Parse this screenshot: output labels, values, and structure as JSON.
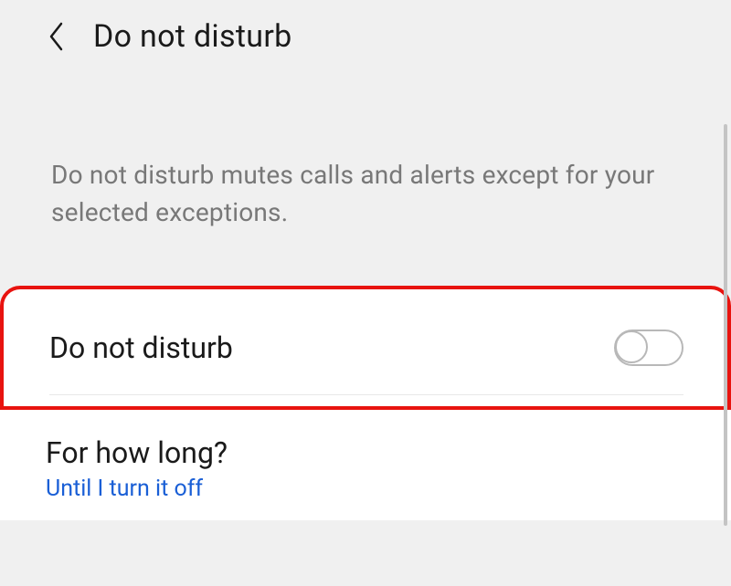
{
  "header": {
    "title": "Do not disturb"
  },
  "description": "Do not disturb mutes calls and alerts except for your selected exceptions.",
  "rows": {
    "dnd": {
      "label": "Do not disturb",
      "enabled": false
    },
    "duration": {
      "label": "For how long?",
      "value": "Until I turn it off"
    }
  }
}
